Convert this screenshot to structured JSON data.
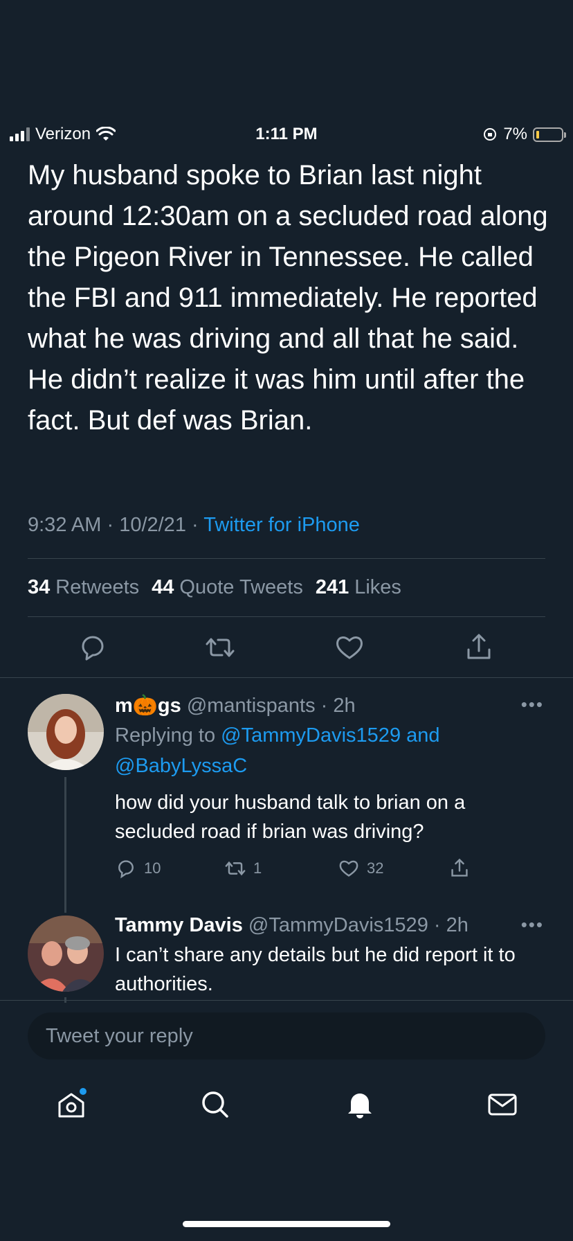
{
  "status_bar": {
    "carrier": "Verizon",
    "time": "1:11 PM",
    "battery": "7%"
  },
  "tweet": {
    "text": "My husband spoke to Brian last night around 12:30am on a secluded road along the Pigeon River in Tennessee. He called the FBI and 911 immediately. He reported what he was driving and all that he said. He didn’t realize it was him until after the fact. But def was Brian.",
    "time": "9:32 AM",
    "date": "10/2/21",
    "source": "Twitter for iPhone",
    "retweets": "34",
    "retweets_label": "Retweets",
    "quotes": "44",
    "quotes_label": "Quote Tweets",
    "likes": "241",
    "likes_label": "Likes"
  },
  "replies": [
    {
      "name_prefix": "m",
      "name_emoji": "🎃",
      "name_suffix": "gs",
      "handle": "@mantispants",
      "time": "2h",
      "replying_to": "Replying to",
      "mention1": "@TammyDavis1529",
      "and": "and",
      "mention2": "@BabyLyssaC",
      "text": "how did your husband talk to brian on a secluded road if brian was driving?",
      "reply_count": "10",
      "retweet_count": "1",
      "like_count": "32"
    },
    {
      "name": "Tammy Davis",
      "handle": "@TammyDavis1529",
      "time": "2h",
      "text": "I can’t share any details but he did report it to authorities."
    }
  ],
  "reply_box": {
    "placeholder": "Tweet your reply"
  },
  "colors": {
    "background": "#15202b",
    "accent": "#1d9bf0",
    "muted": "#8b98a5",
    "divider": "#38444d"
  },
  "tabbar": [
    "home-icon",
    "search-icon",
    "notifications-icon",
    "messages-icon"
  ]
}
